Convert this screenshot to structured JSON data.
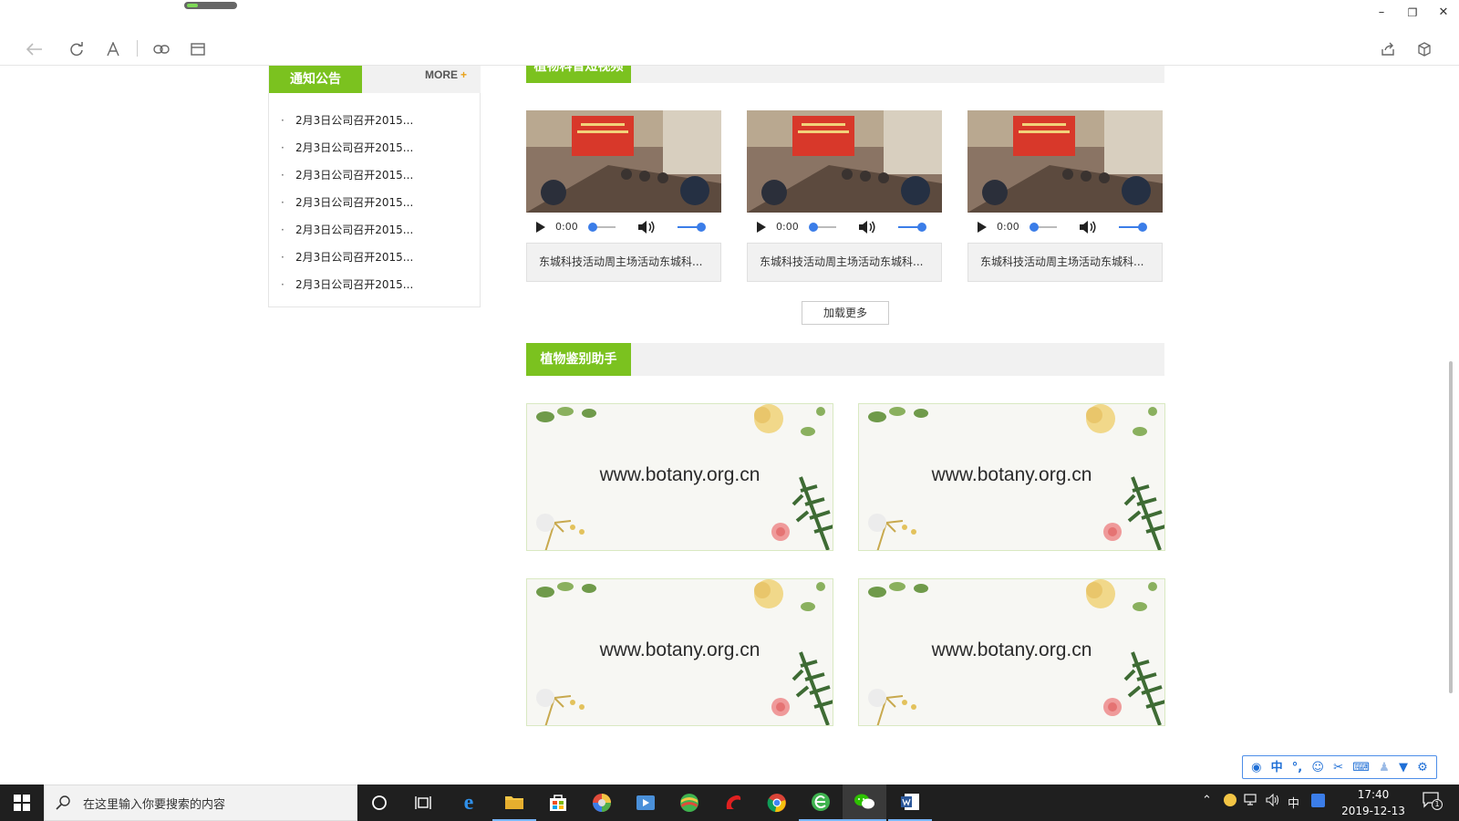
{
  "window": {
    "minimize": "–",
    "restore": "❐",
    "close": "✕"
  },
  "notice": {
    "title": "通知公告",
    "more": "MORE",
    "more_plus": "+",
    "items": [
      "2月3日公司召开2015...",
      "2月3日公司召开2015...",
      "2月3日公司召开2015...",
      "2月3日公司召开2015...",
      "2月3日公司召开2015...",
      "2月3日公司召开2015...",
      "2月3日公司召开2015..."
    ]
  },
  "videos": {
    "section_title": "植物科普短视频",
    "items": [
      {
        "time": "0:00",
        "caption": "东城科技活动周主场活动东城科..."
      },
      {
        "time": "0:00",
        "caption": "东城科技活动周主场活动东城科..."
      },
      {
        "time": "0:00",
        "caption": "东城科技活动周主场活动东城科..."
      }
    ],
    "load_more": "加载更多"
  },
  "plant_id": {
    "section_title": "植物鉴别助手",
    "cards": [
      {
        "url": "www.botany.org.cn"
      },
      {
        "url": "www.botany.org.cn"
      },
      {
        "url": "www.botany.org.cn"
      },
      {
        "url": "www.botany.org.cn"
      }
    ]
  },
  "ime": {
    "chinese_mode": "中"
  },
  "taskbar": {
    "search_placeholder": "在这里输入你要搜索的内容",
    "tray_lang": "中",
    "time": "17:40",
    "date": "2019-12-13",
    "notification_count": "1"
  },
  "colors": {
    "accent_green": "#7bc21f",
    "header_gray": "#f1f1f1",
    "media_blue": "#3b7de8"
  }
}
